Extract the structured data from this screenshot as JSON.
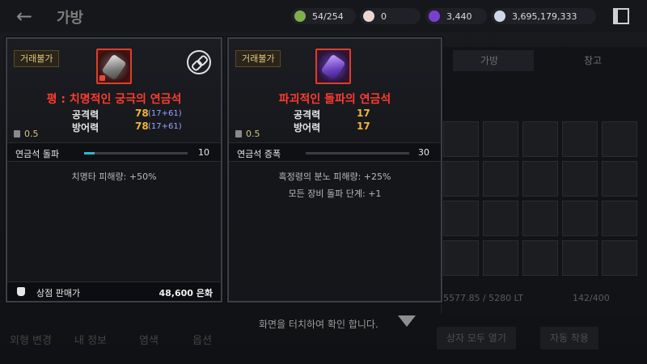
{
  "header": {
    "title": "가방",
    "currencies": [
      {
        "icon": "inventory-slot-icon",
        "value": "54/254",
        "color": "#7fb04a"
      },
      {
        "icon": "pearl-icon",
        "value": "0",
        "color": "#e8d8d0"
      },
      {
        "icon": "purple-gem-icon",
        "value": "3,440",
        "color": "#7a3fd0"
      },
      {
        "icon": "silver-coin-icon",
        "value": "3,695,179,333",
        "color": "#cfd8e8"
      }
    ]
  },
  "background": {
    "tabs": [
      "가방",
      "창고"
    ],
    "weight": "5577.85 / 5280 LT",
    "slot_count": "142/400",
    "bottom_tabs": [
      "외형 변경",
      "내 정보",
      "염색",
      "옵션"
    ],
    "open_all": "상자 모두 열기",
    "auto_equip": "자동 착용",
    "tap_hint": "화면을 터치하여 확인 합니다."
  },
  "left_card": {
    "trade_badge": "거래불가",
    "name": "평 : 치명적인 궁극의 연금석",
    "stats": [
      {
        "label": "공격력",
        "value": "78",
        "extra": "(17+61)"
      },
      {
        "label": "방어력",
        "value": "78",
        "extra": "(17+61)"
      }
    ],
    "weight": "0.5",
    "bar_label": "연금석 돌파",
    "bar_value": "10",
    "bar_fill_percent": 10,
    "effect": "치명타 피해량: +50%",
    "sell_label": "상점 판매가",
    "sell_price": "48,600 은화"
  },
  "right_card": {
    "trade_badge": "거래불가",
    "name": "파괴적인 돌파의 연금석",
    "stats": [
      {
        "label": "공격력",
        "value": "17",
        "extra": ""
      },
      {
        "label": "방어력",
        "value": "17",
        "extra": ""
      }
    ],
    "weight": "0.5",
    "bar_label": "연금석 증폭",
    "bar_value": "30",
    "bar_fill_percent": 0,
    "effects": [
      "흑정령의 분노 피해량: +25%",
      "모든 장비 돌파 단계: +1"
    ]
  },
  "colors": {
    "item_name": "#ff3b2f",
    "stat_value": "#f2b43a",
    "bar_fill": "#2fb6d6"
  }
}
